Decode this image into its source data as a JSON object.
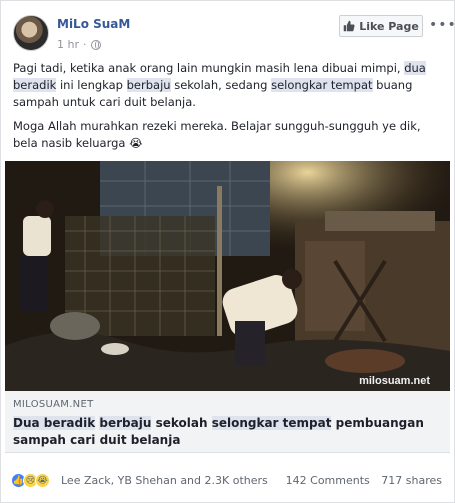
{
  "header": {
    "page_name": "MiLo SuaM",
    "time": "1 hr",
    "like_page_label": "Like Page",
    "more_label": "•••"
  },
  "post": {
    "paragraphs": [
      {
        "segments": [
          {
            "text": "Pagi tadi, ketika anak orang lain mungkin masih lena dibuai mimpi, ",
            "hl": false
          },
          {
            "text": "dua beradik",
            "hl": true
          },
          {
            "text": " ini lengkap ",
            "hl": false
          },
          {
            "text": "berbaju",
            "hl": true
          },
          {
            "text": " sekolah, sedang ",
            "hl": false
          },
          {
            "text": "selongkar tempat",
            "hl": true
          },
          {
            "text": " buang sampah untuk cari duit belanja.",
            "hl": false
          }
        ]
      },
      {
        "segments": [
          {
            "text": "Moga Allah murahkan rezeki mereka. Belajar sungguh-sungguh ye dik, bela nasib keluarga 😭",
            "hl": false
          }
        ]
      }
    ]
  },
  "media": {
    "watermark": "milosuam.net"
  },
  "link": {
    "domain": "MILOSUAM.NET",
    "title_segments": [
      {
        "text": "Dua beradik",
        "hl": true
      },
      {
        "text": " ",
        "hl": false
      },
      {
        "text": "berbaju",
        "hl": true
      },
      {
        "text": " sekolah ",
        "hl": false
      },
      {
        "text": "selongkar tempat",
        "hl": true
      },
      {
        "text": " pembuangan sampah cari duit belanja",
        "hl": false
      }
    ]
  },
  "footer": {
    "reaction_icons": [
      "like-icon",
      "sad-icon",
      "cry-icon"
    ],
    "reactors": "Lee Zack, YB Shehan and 2.3K others",
    "comments": "142 Comments",
    "shares": "717 shares"
  },
  "colors": {
    "link_blue": "#365899",
    "highlight": "#dfe3ee",
    "like_blue": "#4080ff"
  }
}
